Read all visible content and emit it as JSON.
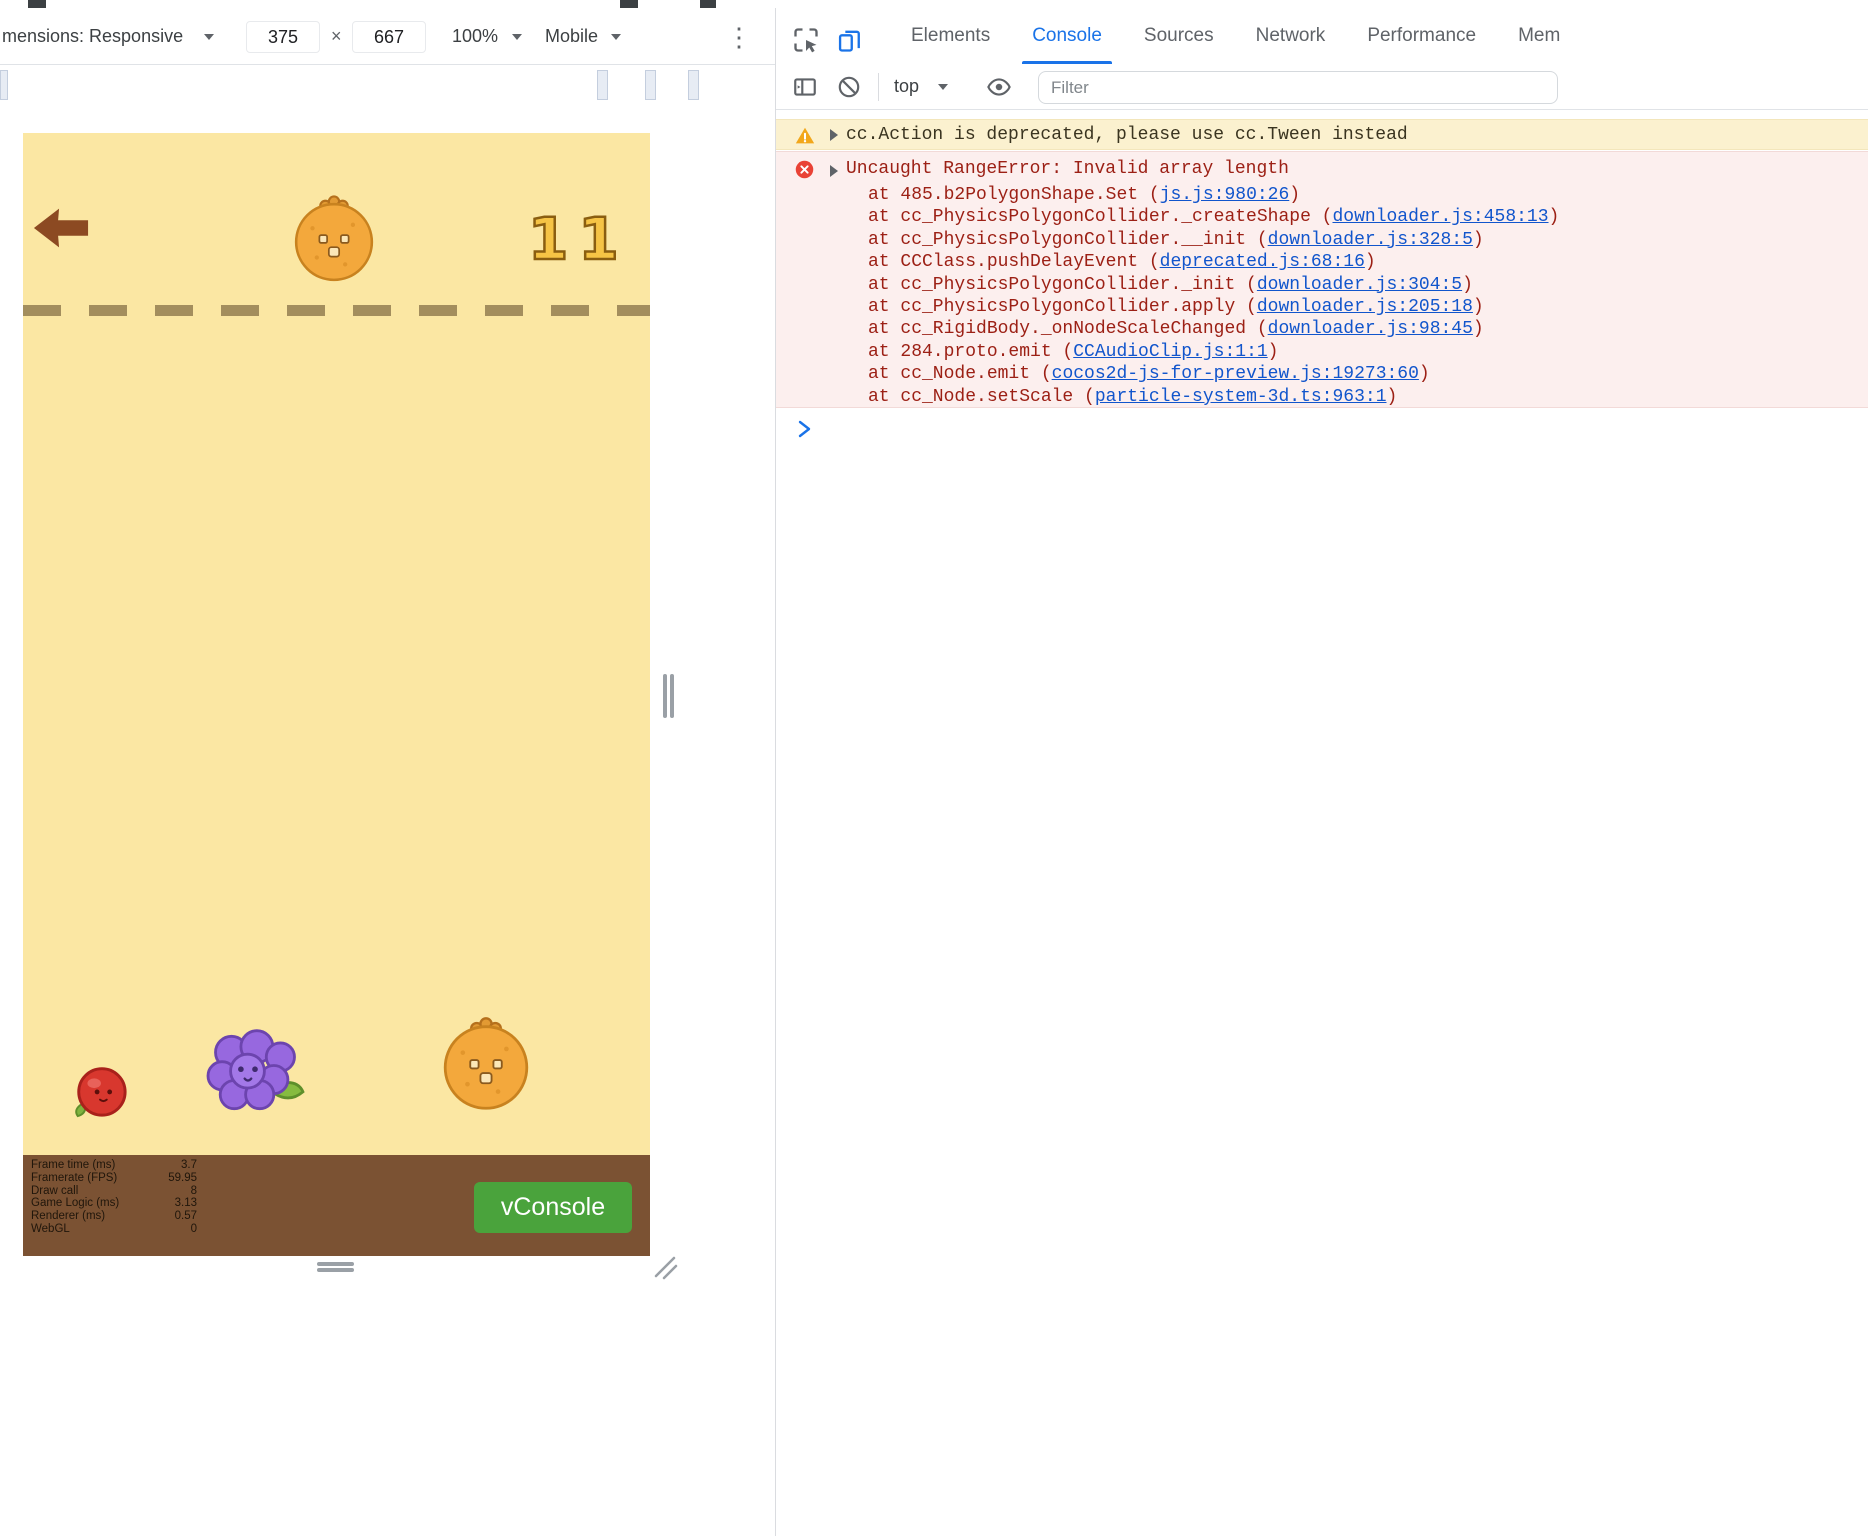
{
  "device_toolbar": {
    "dimensions_label": "mensions: Responsive",
    "width_value": "375",
    "multiply_sign": "×",
    "height_value": "667",
    "zoom_value": "100%",
    "device_type_value": "Mobile",
    "overflow_menu_glyph": "⋮"
  },
  "game": {
    "score": "11",
    "sprites": [
      "orange",
      "apple",
      "grapes",
      "orange"
    ],
    "stats": [
      {
        "label": "Frame time (ms)",
        "value": "3.7"
      },
      {
        "label": "Framerate (FPS)",
        "value": "59.95"
      },
      {
        "label": "Draw call",
        "value": "8"
      },
      {
        "label": "Game Logic (ms)",
        "value": "3.13"
      },
      {
        "label": "Renderer (ms)",
        "value": "0.57"
      },
      {
        "label": "WebGL",
        "value": "0"
      }
    ],
    "vconsole_label": "vConsole"
  },
  "devtools": {
    "tabs": [
      {
        "label": "Elements"
      },
      {
        "label": "Console"
      },
      {
        "label": "Sources"
      },
      {
        "label": "Network"
      },
      {
        "label": "Performance"
      },
      {
        "label": "Mem"
      }
    ],
    "active_tab": "Console",
    "console_toolbar": {
      "context_value": "top",
      "filter_placeholder": "Filter"
    },
    "warning": {
      "text": "cc.Action is deprecated, please use cc.Tween instead"
    },
    "error": {
      "title": "Uncaught RangeError: Invalid array length",
      "stack": [
        {
          "text": "at 485.b2PolygonShape.Set (",
          "link": "js.js:980:26",
          "close": ")"
        },
        {
          "text": "at cc_PhysicsPolygonCollider._createShape (",
          "link": "downloader.js:458:13",
          "close": ")"
        },
        {
          "text": "at cc_PhysicsPolygonCollider.__init (",
          "link": "downloader.js:328:5",
          "close": ")"
        },
        {
          "text": "at CCClass.pushDelayEvent (",
          "link": "deprecated.js:68:16",
          "close": ")"
        },
        {
          "text": "at cc_PhysicsPolygonCollider._init (",
          "link": "downloader.js:304:5",
          "close": ")"
        },
        {
          "text": "at cc_PhysicsPolygonCollider.apply (",
          "link": "downloader.js:205:18",
          "close": ")"
        },
        {
          "text": "at cc_RigidBody._onNodeScaleChanged (",
          "link": "downloader.js:98:45",
          "close": ")"
        },
        {
          "text": "at 284.proto.emit (",
          "link": "CCAudioClip.js:1:1",
          "close": ")"
        },
        {
          "text": "at cc_Node.emit (",
          "link": "cocos2d-js-for-preview.js:19273:60",
          "close": ")"
        },
        {
          "text": "at cc_Node.setScale (",
          "link": "particle-system-3d.ts:963:1",
          "close": ")"
        }
      ]
    }
  },
  "colors": {
    "accent_blue": "#1a73e8",
    "link_blue": "#1155cc",
    "warning_bg": "#fbf1cf",
    "error_bg": "#fcefee",
    "error_text": "#9c2015",
    "game_bg": "#fbe7a3",
    "ground_brown": "#7b5233",
    "vconsole_green": "#4aa33c",
    "score_gold": "#f6c445"
  }
}
